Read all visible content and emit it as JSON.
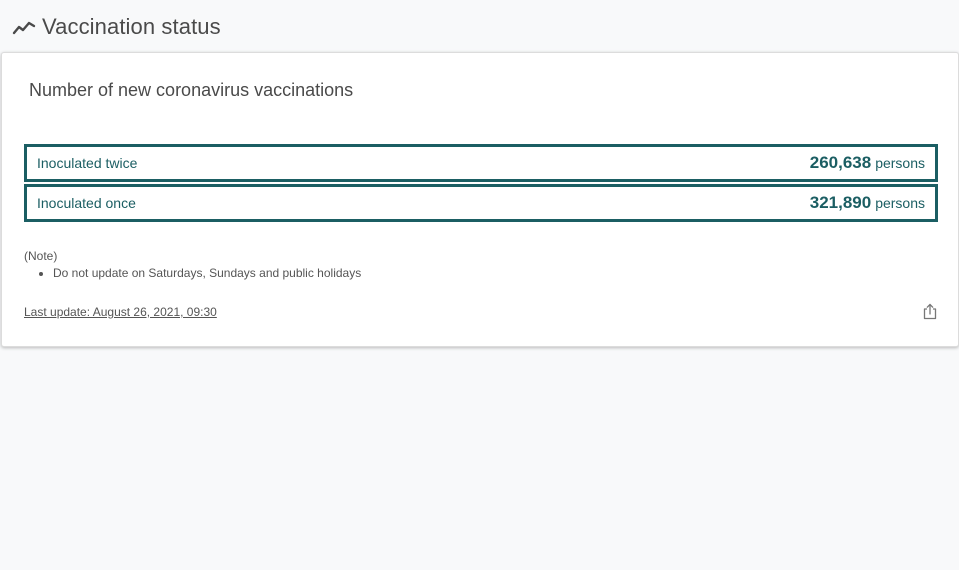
{
  "header": {
    "title": "Vaccination status",
    "icon": "trending-line-icon"
  },
  "card": {
    "title": "Number of new coronavirus vaccinations",
    "stats": [
      {
        "label": "Inoculated twice",
        "value": "260,638",
        "unit": "persons"
      },
      {
        "label": "Inoculated once",
        "value": "321,890",
        "unit": "persons"
      }
    ],
    "note_heading": "(Note)",
    "notes": [
      "Do not update on Saturdays, Sundays and public holidays"
    ],
    "last_update": "Last update: August 26, 2021, 09:30",
    "share_icon": "share-icon"
  },
  "colors": {
    "accent": "#1b5e63",
    "background": "#f8f9fa"
  }
}
